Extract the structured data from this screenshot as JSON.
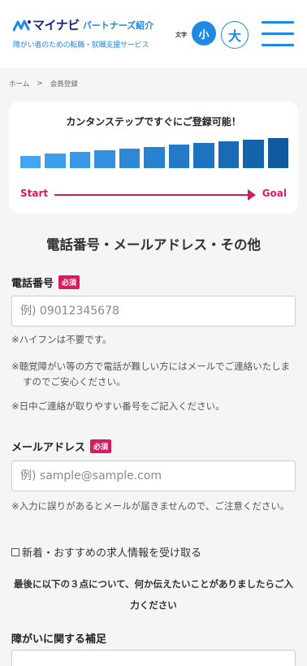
{
  "header": {
    "logo_name": "マイナビ",
    "logo_sub": "パートナーズ紹介",
    "tagline": "障がい者のための転職・就職支援サービス",
    "font_size_label": "文字",
    "font_small": "小",
    "font_large": "大",
    "brand_color": "#1e88e5"
  },
  "breadcrumb": {
    "home": "ホーム",
    "separator": ">",
    "current": "会員登録"
  },
  "steps": {
    "title": "カンタンステップですぐにご登録可能！",
    "start": "Start",
    "goal": "Goal",
    "levels": [
      0.35,
      0.4,
      0.45,
      0.5,
      0.55,
      0.6,
      0.65,
      0.7,
      0.75,
      0.8,
      0.85
    ],
    "colors": [
      "#42a5f5",
      "#3d9eee",
      "#3897e6",
      "#3290df",
      "#2d89d7",
      "#2882d0",
      "#237bc8",
      "#1e73c0",
      "#1a6bb6",
      "#1563ab",
      "#115a9e"
    ]
  },
  "section_title": "電話番号・メールアドレス・その他",
  "required_badge": "必須",
  "phone": {
    "label": "電話番号",
    "placeholder": "例) 09012345678",
    "notes": [
      "※ハイフンは不要です。",
      "※聴覚障がい等の方で電話が難しい方にはメールでご連絡いたしますのでご安心ください。",
      "※日中ご連絡が取りやすい番号をご記入ください。"
    ]
  },
  "email": {
    "label": "メールアドレス",
    "placeholder": "例) sample@sample.com",
    "note": "※入力に誤りがあるとメールが届きませんので、ご注意ください。"
  },
  "newsletter": {
    "label": "新着・おすすめの求人情報を受け取る"
  },
  "final_note": "最後に以下の３点について、何か伝えたいことがありましたらご入力ください",
  "disability": {
    "label": "障がいに関する補足"
  }
}
